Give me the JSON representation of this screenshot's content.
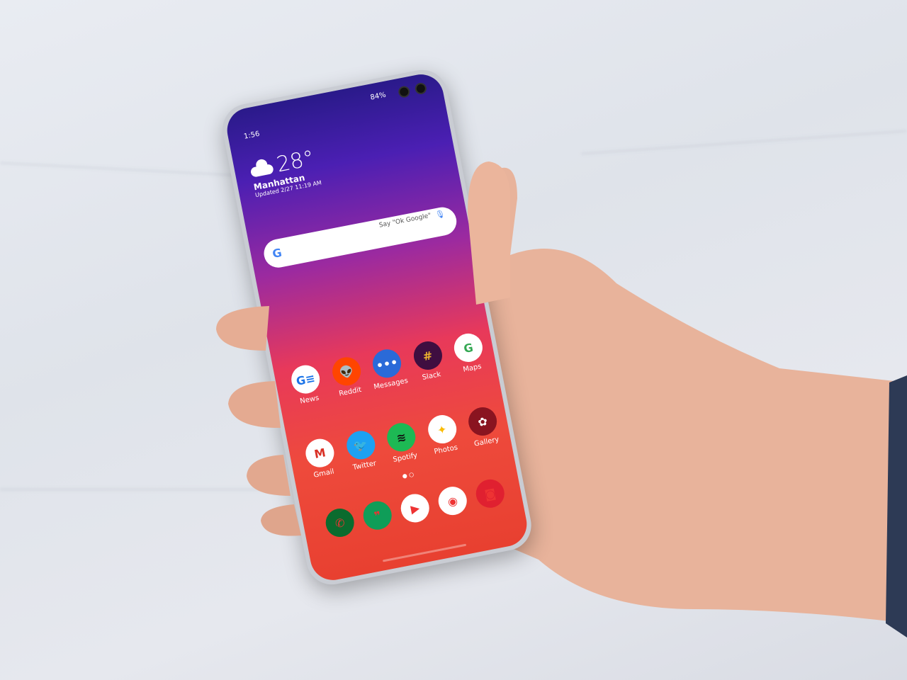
{
  "status_bar": {
    "time": "1:56",
    "battery": "84%"
  },
  "weather": {
    "temperature": "28°",
    "location": "Manhattan",
    "updated": "Updated 2/27 11:19 AM"
  },
  "search": {
    "logo": "G",
    "hint": "Say \"Ok Google\""
  },
  "apps_row1": [
    {
      "label": "News",
      "color": "#ffffff",
      "fg": "#1a73e8",
      "glyph": "G≡"
    },
    {
      "label": "Reddit",
      "color": "#ff4500",
      "fg": "#fff",
      "glyph": "👽"
    },
    {
      "label": "Messages",
      "color": "#2a6ad8",
      "fg": "#fff",
      "glyph": "•••"
    },
    {
      "label": "Slack",
      "color": "#3f0e40",
      "fg": "#ecb22e",
      "glyph": "#"
    },
    {
      "label": "Maps",
      "color": "#ffffff",
      "fg": "#34a853",
      "glyph": "G"
    }
  ],
  "apps_row2": [
    {
      "label": "Gmail",
      "color": "#ffffff",
      "fg": "#d93025",
      "glyph": "M"
    },
    {
      "label": "Twitter",
      "color": "#1da1f2",
      "fg": "#fff",
      "glyph": "🐦"
    },
    {
      "label": "Spotify",
      "color": "#1db954",
      "fg": "#111",
      "glyph": "≋"
    },
    {
      "label": "Photos",
      "color": "#ffffff",
      "fg": "#fbbc04",
      "glyph": "✦"
    },
    {
      "label": "Gallery",
      "color": "#8a1420",
      "fg": "#fff",
      "glyph": "✿"
    }
  ],
  "dock": [
    {
      "name": "phone",
      "color": "#0b6b2e",
      "glyph": "✆"
    },
    {
      "name": "hangouts",
      "color": "#0f9d58",
      "glyph": "❞"
    },
    {
      "name": "youtube",
      "color": "#ffffff",
      "glyph": "▶"
    },
    {
      "name": "chrome",
      "color": "#ffffff",
      "glyph": "◉"
    },
    {
      "name": "camera",
      "color": "#e02030",
      "glyph": "◙"
    }
  ],
  "colors": {
    "skin": "#e9b49a",
    "background": "#e3e6ec"
  }
}
